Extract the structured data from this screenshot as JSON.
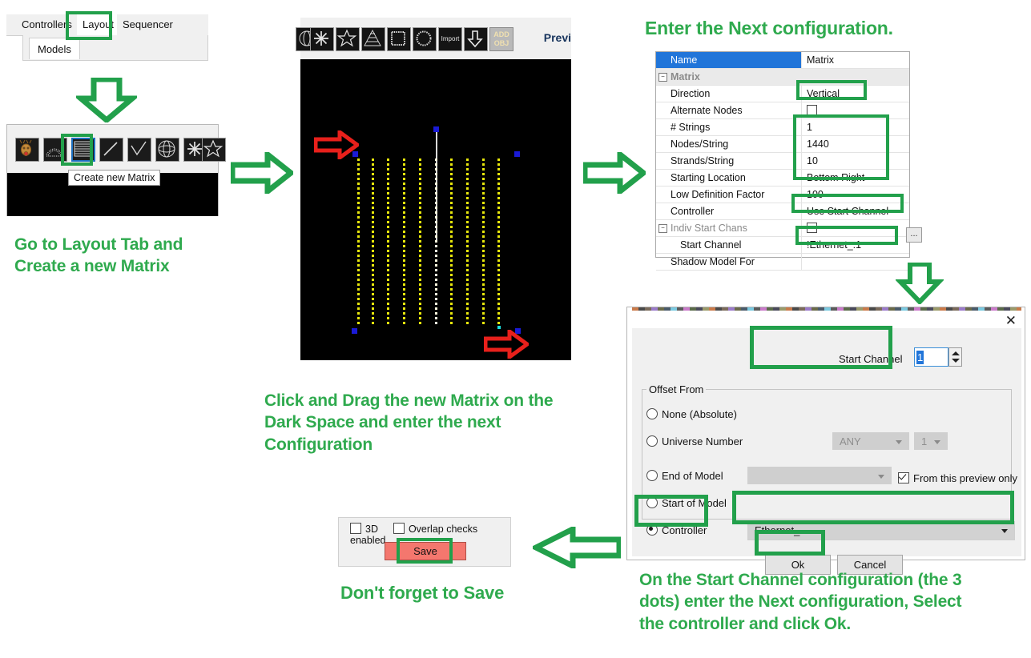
{
  "colors": {
    "accent_green": "#22a04b",
    "caption_green": "#2faa4e",
    "arrow_red": "#e8201b",
    "save_red": "#f4776e",
    "select_blue": "#2175d9",
    "node_yellow": "#e8e80c",
    "handle_blue": "#1a1ad6"
  },
  "tabs_panel": {
    "tabs": [
      {
        "label": "Controllers",
        "selected": false
      },
      {
        "label": "Layout",
        "selected": true
      },
      {
        "label": "Sequencer",
        "selected": false
      }
    ],
    "subtab": "Models"
  },
  "icon_panel": {
    "icons": [
      "reindeer-icon",
      "arch-icon",
      "matrix-icon",
      "line-icon",
      "polyline-icon",
      "sphere-icon",
      "star-burst-icon",
      "star-icon",
      "partial-icon"
    ],
    "selected_icon": "matrix-icon",
    "tooltip": "Create new Matrix"
  },
  "caption_layout": "Go to Layout Tab and\nCreate a new Matrix",
  "preview": {
    "toolbar_icons": [
      "sphere-icon",
      "star-burst-icon",
      "star-icon",
      "tree-icon",
      "square-icon",
      "circle-icon",
      "import-icon",
      "down-arrow-icon",
      "add-obj-icon"
    ],
    "import_label": "Import",
    "addobj_label_line1": "ADD",
    "addobj_label_line2": "OBJ",
    "title": "Previ",
    "strand_count": 10,
    "caption": "Click and Drag the new Matrix on the\nDark Space and enter the next\nConfiguration"
  },
  "caption_enter_next": "Enter the Next configuration.",
  "property_grid": {
    "rows": [
      {
        "name": "Name",
        "value": "Matrix",
        "type": "header"
      },
      {
        "name": "Matrix",
        "value": "",
        "type": "group"
      },
      {
        "name": "Direction",
        "value": "Vertical",
        "type": "text",
        "highlight": true
      },
      {
        "name": "Alternate Nodes",
        "value": "",
        "type": "checkbox",
        "checked": false
      },
      {
        "name": "# Strings",
        "value": "1",
        "type": "text",
        "highlight": true
      },
      {
        "name": "Nodes/String",
        "value": "1440",
        "type": "text",
        "highlight": true
      },
      {
        "name": "Strands/String",
        "value": "10",
        "type": "text",
        "highlight": true
      },
      {
        "name": "Starting Location",
        "value": "Bottom Right",
        "type": "text",
        "highlight": true
      },
      {
        "name": "Low Definition Factor",
        "value": "100",
        "type": "text"
      },
      {
        "name": "Controller",
        "value": "Use Start Channel",
        "type": "text",
        "highlight": true
      },
      {
        "name": "Indiv Start Chans",
        "value": "",
        "type": "checkbox",
        "checked": false,
        "group2": true
      },
      {
        "name": "Start Channel",
        "value": "!Ethernet_:1",
        "type": "text",
        "highlight": true,
        "indent": true
      },
      {
        "name": "Shadow Model For",
        "value": "",
        "type": "text"
      }
    ],
    "dots_button": "..."
  },
  "dialog": {
    "close_icon": "close-icon",
    "start_channel_label": "Start Channel",
    "start_channel_value": "1",
    "group_label": "Offset From",
    "options": [
      {
        "label": "None (Absolute)",
        "selected": false
      },
      {
        "label": "Universe Number",
        "selected": false
      },
      {
        "label": "End of Model",
        "selected": false
      },
      {
        "label": "Start of Model",
        "selected": false
      },
      {
        "label": "Controller",
        "selected": true
      }
    ],
    "universe_combo": "ANY",
    "universe_num_combo": "1",
    "endmodel_combo": "",
    "controller_combo": "Ethernet_",
    "preview_checkbox_label": "From this preview only",
    "preview_checkbox_checked": true,
    "ok_label": "Ok",
    "cancel_label": "Cancel",
    "caption": "On the Start Channel configuration (the 3\ndots) enter the Next configuration, Select\nthe controller and click Ok."
  },
  "save_panel": {
    "chk_3d_label": "3D",
    "chk_3d_checked": false,
    "chk_overlap_label": "Overlap checks enabled",
    "chk_overlap_checked": false,
    "save_label": "Save",
    "caption": "Don't forget to Save"
  }
}
